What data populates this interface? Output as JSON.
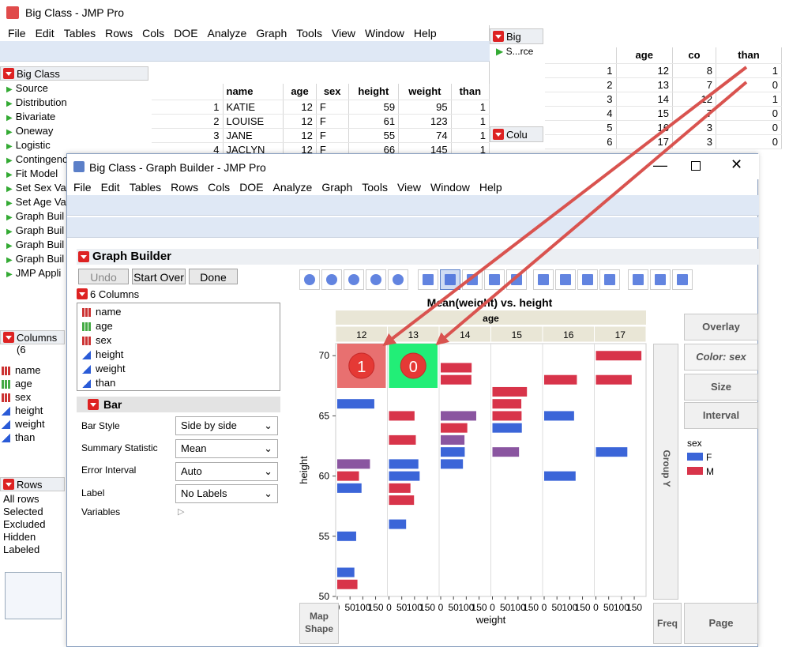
{
  "main_window": {
    "title": "Big Class - JMP Pro",
    "menu": [
      "File",
      "Edit",
      "Tables",
      "Rows",
      "Cols",
      "DOE",
      "Analyze",
      "Graph",
      "Tools",
      "View",
      "Window",
      "Help"
    ],
    "panel_title": "Big Class",
    "scripts": [
      "Source",
      "Distribution",
      "Bivariate",
      "Oneway",
      "Logistic",
      "Contingency",
      "Fit Model",
      "Set Sex Va",
      "Set Age Va",
      "Graph Buil",
      "Graph Buil",
      "Graph Buil",
      "Graph Buil",
      "JMP Appli"
    ],
    "columns_title": "Columns (6",
    "columns": [
      "name",
      "age",
      "sex",
      "height",
      "weight",
      "than"
    ],
    "rows_title": "Rows",
    "rows": [
      [
        "All rows",
        ""
      ],
      [
        "Selected",
        ""
      ],
      [
        "Excluded",
        ""
      ],
      [
        "Hidden",
        ""
      ],
      [
        "Labeled",
        ""
      ]
    ],
    "table_headers": [
      "name",
      "age",
      "sex",
      "height",
      "weight",
      "than"
    ],
    "table_rows": [
      [
        "1",
        "KATIE",
        "12",
        "F",
        "59",
        "95",
        "1"
      ],
      [
        "2",
        "LOUISE",
        "12",
        "F",
        "61",
        "123",
        "1"
      ],
      [
        "3",
        "JANE",
        "12",
        "F",
        "55",
        "74",
        "1"
      ],
      [
        "4",
        "JACLYN",
        "12",
        "F",
        "66",
        "145",
        "1"
      ]
    ]
  },
  "right_window": {
    "panel_title": "Big",
    "source_label": "S...rce",
    "columns_label": "Colu",
    "headers": [
      "age",
      "co",
      "than"
    ],
    "rows": [
      [
        "1",
        "12",
        "8",
        "1"
      ],
      [
        "2",
        "13",
        "7",
        "0"
      ],
      [
        "3",
        "14",
        "12",
        "1"
      ],
      [
        "4",
        "15",
        "7",
        "0"
      ],
      [
        "5",
        "16",
        "3",
        "0"
      ],
      [
        "6",
        "17",
        "3",
        "0"
      ]
    ]
  },
  "gb_window": {
    "title": "Big Class - Graph Builder - JMP Pro",
    "menu": [
      "File",
      "Edit",
      "Tables",
      "Rows",
      "Cols",
      "DOE",
      "Analyze",
      "Graph",
      "Tools",
      "View",
      "Window",
      "Help"
    ],
    "section_title": "Graph Builder",
    "undo": "Undo",
    "start_over": "Start Over",
    "done": "Done",
    "columns_title": "6 Columns",
    "columns": [
      "name",
      "age",
      "sex",
      "height",
      "weight",
      "than"
    ],
    "bar_title": "Bar",
    "bar_style_label": "Bar Style",
    "bar_style_value": "Side by side",
    "summary_label": "Summary Statistic",
    "summary_value": "Mean",
    "error_label": "Error Interval",
    "error_value": "Auto",
    "label_label": "Label",
    "label_value": "No Labels",
    "variables_label": "Variables",
    "overlay": "Overlay",
    "color": "Color: sex",
    "size": "Size",
    "interval": "Interval",
    "group_y": "Group Y",
    "freq": "Freq",
    "page": "Page",
    "map_shape": "Map Shape",
    "legend_title": "sex",
    "legend_f": "F",
    "legend_m": "M"
  },
  "chart_data": {
    "type": "bar",
    "title": "Mean(weight) vs. height",
    "group_label": "age",
    "groups": [
      "12",
      "13",
      "14",
      "15",
      "16",
      "17"
    ],
    "xlabel": "weight",
    "ylabel": "height",
    "x_ticks": [
      "0",
      "50",
      "100",
      "150"
    ],
    "y_ticks": [
      "50",
      "55",
      "60",
      "65",
      "70"
    ],
    "ylim": [
      50,
      71
    ],
    "xlim": [
      0,
      190
    ],
    "series_colors": {
      "F": "#3b65d8",
      "M": "#d8344a",
      "both": "#8a55a0"
    },
    "bars": [
      {
        "group": "12",
        "height": 66,
        "weight": 145,
        "sex": "F"
      },
      {
        "group": "12",
        "height": 61,
        "weight": 128,
        "sex": "both"
      },
      {
        "group": "12",
        "height": 60,
        "weight": 85,
        "sex": "M"
      },
      {
        "group": "12",
        "height": 59,
        "weight": 95,
        "sex": "F"
      },
      {
        "group": "12",
        "height": 55,
        "weight": 74,
        "sex": "F"
      },
      {
        "group": "12",
        "height": 52,
        "weight": 67,
        "sex": "F"
      },
      {
        "group": "12",
        "height": 51,
        "weight": 79,
        "sex": "M"
      },
      {
        "group": "13",
        "height": 65,
        "weight": 100,
        "sex": "M"
      },
      {
        "group": "13",
        "height": 63,
        "weight": 105,
        "sex": "M"
      },
      {
        "group": "13",
        "height": 61,
        "weight": 115,
        "sex": "F"
      },
      {
        "group": "13",
        "height": 60,
        "weight": 120,
        "sex": "F"
      },
      {
        "group": "13",
        "height": 59,
        "weight": 84,
        "sex": "M"
      },
      {
        "group": "13",
        "height": 58,
        "weight": 98,
        "sex": "M"
      },
      {
        "group": "13",
        "height": 56,
        "weight": 67,
        "sex": "F"
      },
      {
        "group": "14",
        "height": 69,
        "weight": 121,
        "sex": "M"
      },
      {
        "group": "14",
        "height": 68,
        "weight": 120,
        "sex": "M"
      },
      {
        "group": "14",
        "height": 65,
        "weight": 139,
        "sex": "both"
      },
      {
        "group": "14",
        "height": 64,
        "weight": 104,
        "sex": "M"
      },
      {
        "group": "14",
        "height": 63,
        "weight": 93,
        "sex": "both"
      },
      {
        "group": "14",
        "height": 62,
        "weight": 94,
        "sex": "F"
      },
      {
        "group": "14",
        "height": 61,
        "weight": 87,
        "sex": "F"
      },
      {
        "group": "15",
        "height": 67,
        "weight": 135,
        "sex": "M"
      },
      {
        "group": "15",
        "height": 66,
        "weight": 113,
        "sex": "M"
      },
      {
        "group": "15",
        "height": 65,
        "weight": 114,
        "sex": "M"
      },
      {
        "group": "15",
        "height": 64,
        "weight": 115,
        "sex": "F"
      },
      {
        "group": "15",
        "height": 62,
        "weight": 104,
        "sex": "both"
      },
      {
        "group": "16",
        "height": 68,
        "weight": 128,
        "sex": "M"
      },
      {
        "group": "16",
        "height": 65,
        "weight": 117,
        "sex": "F"
      },
      {
        "group": "16",
        "height": 60,
        "weight": 123,
        "sex": "F"
      },
      {
        "group": "17",
        "height": 70,
        "weight": 178,
        "sex": "M"
      },
      {
        "group": "17",
        "height": 68,
        "weight": 140,
        "sex": "M"
      },
      {
        "group": "17",
        "height": 62,
        "weight": 123,
        "sex": "F"
      }
    ],
    "annotations": [
      {
        "group": "12",
        "value": "1",
        "color": "#e87070"
      },
      {
        "group": "13",
        "value": "0",
        "color": "#22ee77"
      }
    ]
  }
}
